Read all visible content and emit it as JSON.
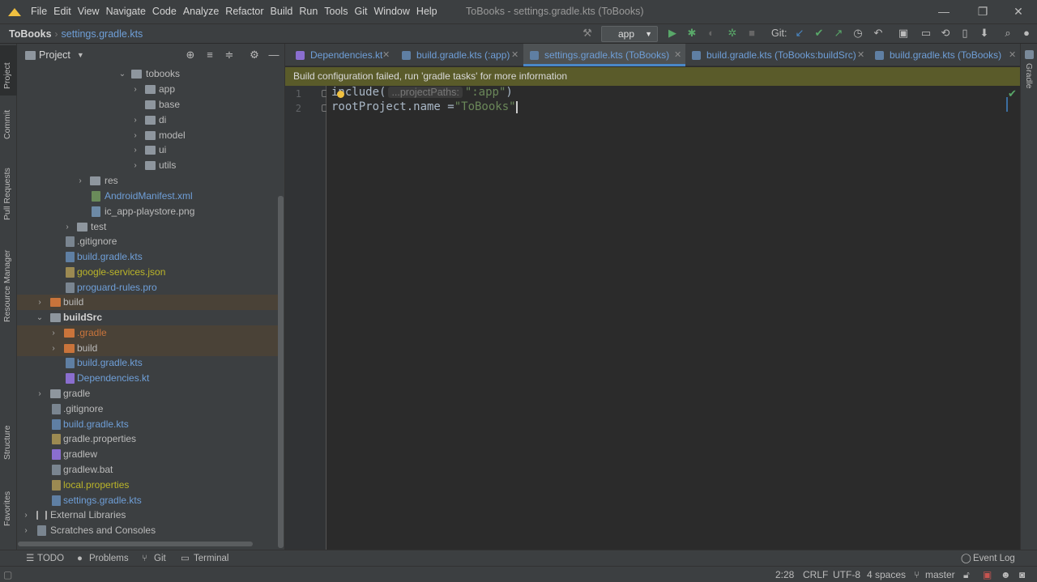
{
  "window": {
    "title": "ToBooks - settings.gradle.kts (ToBooks)",
    "menu": [
      "File",
      "Edit",
      "View",
      "Navigate",
      "Code",
      "Analyze",
      "Refactor",
      "Build",
      "Run",
      "Tools",
      "Git",
      "Window",
      "Help"
    ]
  },
  "breadcrumb": {
    "project": "ToBooks",
    "file": "settings.gradle.kts"
  },
  "toolbar": {
    "run_config": "app",
    "git_label": "Git:"
  },
  "project_panel": {
    "title": "Project",
    "tree": [
      "tobooks",
      "app",
      "base",
      "di",
      "model",
      "ui",
      "utils",
      "res",
      "AndroidManifest.xml",
      "ic_app-playstore.png",
      "test",
      ".gitignore",
      "build.gradle.kts",
      "google-services.json",
      "proguard-rules.pro",
      "build",
      "buildSrc",
      ".gradle",
      "build",
      "build.gradle.kts",
      "Dependencies.kt",
      "gradle",
      ".gitignore",
      "build.gradle.kts",
      "gradle.properties",
      "gradlew",
      "gradlew.bat",
      "local.properties",
      "settings.gradle.kts",
      "External Libraries",
      "Scratches and Consoles"
    ]
  },
  "tabs": [
    "Dependencies.kt",
    "build.gradle.kts (:app)",
    "settings.gradle.kts (ToBooks)",
    "build.gradle.kts (ToBooks:buildSrc)",
    "build.gradle.kts (ToBooks)"
  ],
  "banner": "Build configuration failed, run 'gradle tasks' for more information",
  "editor": {
    "line_numbers": [
      "1",
      "2"
    ],
    "line1": {
      "pre": "include(",
      "hint": "...projectPaths:",
      "str": "\":app\"",
      "post": ")"
    },
    "line2": {
      "pre": "rootProject.name =",
      "str": "\"ToBooks\""
    }
  },
  "left_tool_tabs": [
    "Project",
    "Commit",
    "Pull Requests",
    "Resource Manager",
    "Structure",
    "Favorites"
  ],
  "right_tool_tabs": [
    "Gradle"
  ],
  "bottom_tool_windows": [
    "TODO",
    "Problems",
    "Git",
    "Terminal"
  ],
  "event_log": "Event Log",
  "status": {
    "position": "2:28",
    "line_sep": "CRLF",
    "encoding": "UTF-8",
    "indent": "4 spaces",
    "branch": "master"
  }
}
